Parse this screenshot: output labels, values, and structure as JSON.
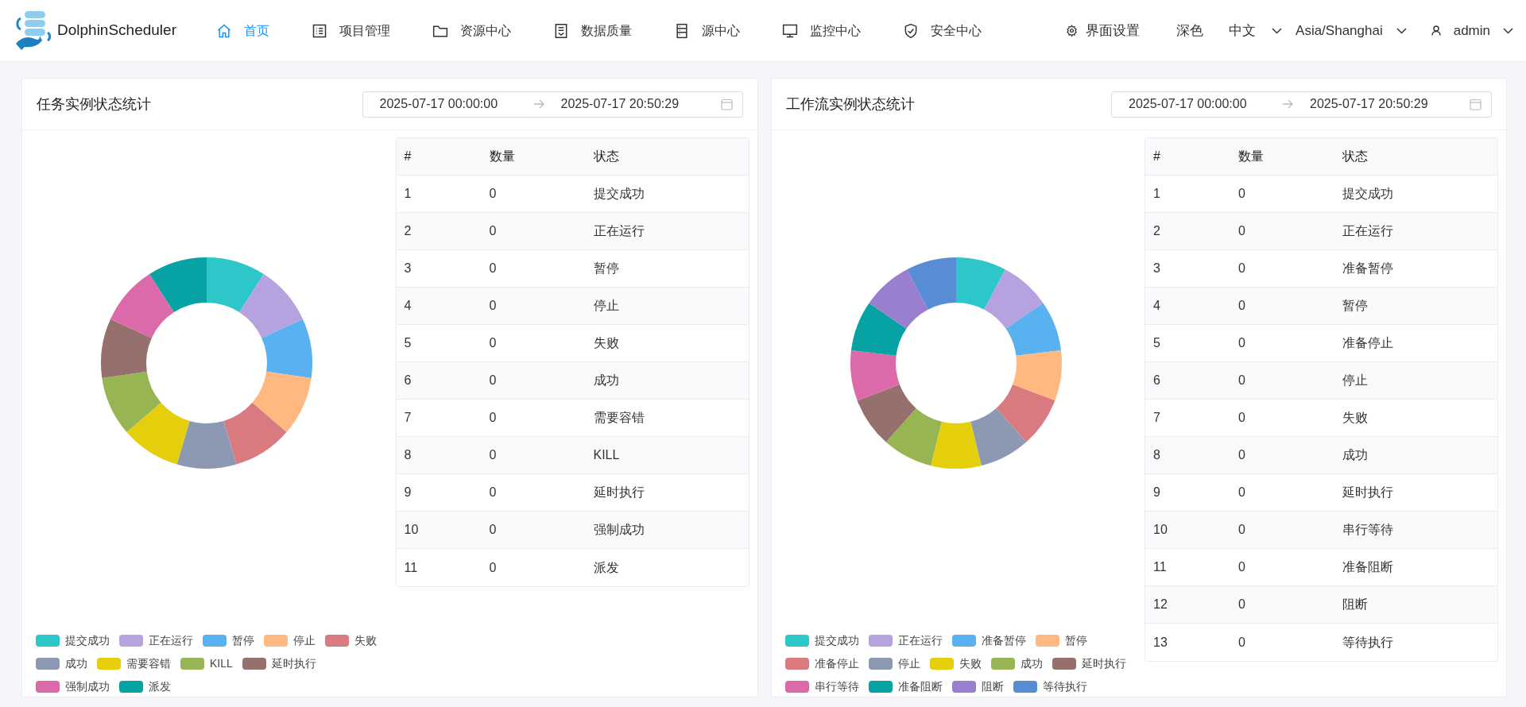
{
  "header": {
    "brand": "DolphinScheduler",
    "nav": [
      {
        "label": "首页",
        "kind": "home",
        "selected": true
      },
      {
        "label": "项目管理",
        "kind": "list",
        "selected": false
      },
      {
        "label": "资源中心",
        "kind": "folder",
        "selected": false
      },
      {
        "label": "数据质量",
        "kind": "doc",
        "selected": false
      },
      {
        "label": "源中心",
        "kind": "server",
        "selected": false
      },
      {
        "label": "监控中心",
        "kind": "monitor",
        "selected": false
      },
      {
        "label": "安全中心",
        "kind": "shield",
        "selected": false
      }
    ],
    "settings": "界面设置",
    "theme": "深色",
    "language": "中文",
    "timezone": "Asia/Shanghai",
    "user": "admin"
  },
  "panels": [
    {
      "title": "任务实例状态统计",
      "date_start": "2025-07-17 00:00:00",
      "date_end": "2025-07-17 20:50:29",
      "table": {
        "columns": [
          "#",
          "数量",
          "状态"
        ],
        "rows": [
          [
            "1",
            "0",
            "提交成功"
          ],
          [
            "2",
            "0",
            "正在运行"
          ],
          [
            "3",
            "0",
            "暂停"
          ],
          [
            "4",
            "0",
            "停止"
          ],
          [
            "5",
            "0",
            "失败"
          ],
          [
            "6",
            "0",
            "成功"
          ],
          [
            "7",
            "0",
            "需要容错"
          ],
          [
            "8",
            "0",
            "KILL"
          ],
          [
            "9",
            "0",
            "延时执行"
          ],
          [
            "10",
            "0",
            "强制成功"
          ],
          [
            "11",
            "0",
            "派发"
          ]
        ]
      },
      "legend": [
        {
          "label": "提交成功",
          "color": "#2ec7c9"
        },
        {
          "label": "正在运行",
          "color": "#b6a2de"
        },
        {
          "label": "暂停",
          "color": "#5ab1ef"
        },
        {
          "label": "停止",
          "color": "#ffb980"
        },
        {
          "label": "失败",
          "color": "#d87a80"
        },
        {
          "label": "成功",
          "color": "#8d98b3"
        },
        {
          "label": "需要容错",
          "color": "#e5cf0d"
        },
        {
          "label": "KILL",
          "color": "#97b552"
        },
        {
          "label": "延时执行",
          "color": "#95706d"
        },
        {
          "label": "强制成功",
          "color": "#dc69aa"
        },
        {
          "label": "派发",
          "color": "#07a2a4"
        }
      ]
    },
    {
      "title": "工作流实例状态统计",
      "date_start": "2025-07-17 00:00:00",
      "date_end": "2025-07-17 20:50:29",
      "table": {
        "columns": [
          "#",
          "数量",
          "状态"
        ],
        "rows": [
          [
            "1",
            "0",
            "提交成功"
          ],
          [
            "2",
            "0",
            "正在运行"
          ],
          [
            "3",
            "0",
            "准备暂停"
          ],
          [
            "4",
            "0",
            "暂停"
          ],
          [
            "5",
            "0",
            "准备停止"
          ],
          [
            "6",
            "0",
            "停止"
          ],
          [
            "7",
            "0",
            "失败"
          ],
          [
            "8",
            "0",
            "成功"
          ],
          [
            "9",
            "0",
            "延时执行"
          ],
          [
            "10",
            "0",
            "串行等待"
          ],
          [
            "11",
            "0",
            "准备阻断"
          ],
          [
            "12",
            "0",
            "阻断"
          ],
          [
            "13",
            "0",
            "等待执行"
          ]
        ]
      },
      "legend": [
        {
          "label": "提交成功",
          "color": "#2ec7c9"
        },
        {
          "label": "正在运行",
          "color": "#b6a2de"
        },
        {
          "label": "准备暂停",
          "color": "#5ab1ef"
        },
        {
          "label": "暂停",
          "color": "#ffb980"
        },
        {
          "label": "准备停止",
          "color": "#d87a80"
        },
        {
          "label": "停止",
          "color": "#8d98b3"
        },
        {
          "label": "失败",
          "color": "#e5cf0d"
        },
        {
          "label": "成功",
          "color": "#97b552"
        },
        {
          "label": "延时执行",
          "color": "#95706d"
        },
        {
          "label": "串行等待",
          "color": "#dc69aa"
        },
        {
          "label": "准备阻断",
          "color": "#07a2a4"
        },
        {
          "label": "阻断",
          "color": "#9a7fd1"
        },
        {
          "label": "等待执行",
          "color": "#588dd5"
        }
      ]
    }
  ]
}
